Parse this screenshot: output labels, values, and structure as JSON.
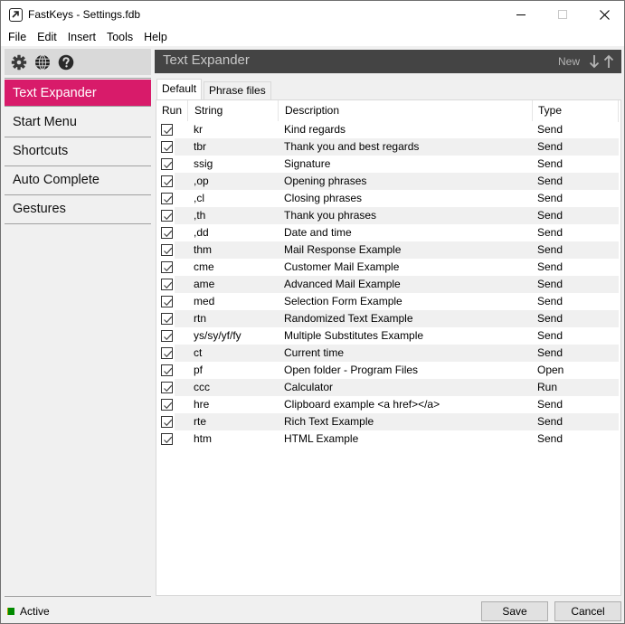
{
  "window": {
    "title": "FastKeys - Settings.fdb",
    "controls": {
      "minimize": "minimize",
      "maximize": "maximize",
      "close": "close"
    }
  },
  "menubar": {
    "items": [
      "File",
      "Edit",
      "Insert",
      "Tools",
      "Help"
    ]
  },
  "sidebar": {
    "toolbar_icons": [
      "gear-icon",
      "globe-icon",
      "help-icon"
    ],
    "items": [
      {
        "label": "Text Expander",
        "active": true
      },
      {
        "label": "Start Menu",
        "active": false
      },
      {
        "label": "Shortcuts",
        "active": false
      },
      {
        "label": "Auto Complete",
        "active": false
      },
      {
        "label": "Gestures",
        "active": false
      }
    ],
    "active_color": "#d81b6a"
  },
  "panel": {
    "title": "Text Expander",
    "new_label": "New",
    "move_down_icon": "arrow-down-icon",
    "move_up_icon": "arrow-up-icon",
    "tabs": [
      {
        "label": "Default",
        "active": true
      },
      {
        "label": "Phrase files",
        "active": false
      }
    ]
  },
  "table": {
    "columns": [
      "Run",
      "String",
      "Description",
      "Type"
    ],
    "rows": [
      {
        "run": true,
        "string": "kr",
        "description": "Kind regards",
        "type": "Send"
      },
      {
        "run": true,
        "string": "tbr",
        "description": "Thank you and best regards",
        "type": "Send"
      },
      {
        "run": true,
        "string": "ssig",
        "description": "Signature",
        "type": "Send"
      },
      {
        "run": true,
        "string": ",op",
        "description": "Opening phrases",
        "type": "Send"
      },
      {
        "run": true,
        "string": ",cl",
        "description": "Closing phrases",
        "type": "Send"
      },
      {
        "run": true,
        "string": ",th",
        "description": "Thank you phrases",
        "type": "Send"
      },
      {
        "run": true,
        "string": ",dd",
        "description": "Date and time",
        "type": "Send"
      },
      {
        "run": true,
        "string": "thm",
        "description": "Mail Response Example",
        "type": "Send"
      },
      {
        "run": true,
        "string": "cme",
        "description": "Customer Mail Example",
        "type": "Send"
      },
      {
        "run": true,
        "string": "ame",
        "description": "Advanced Mail Example",
        "type": "Send"
      },
      {
        "run": true,
        "string": "med",
        "description": "Selection Form Example",
        "type": "Send"
      },
      {
        "run": true,
        "string": "rtn",
        "description": "Randomized Text Example",
        "type": "Send"
      },
      {
        "run": true,
        "string": "ys/sy/yf/fy",
        "description": "Multiple Substitutes Example",
        "type": "Send"
      },
      {
        "run": true,
        "string": "ct",
        "description": "Current time",
        "type": "Send"
      },
      {
        "run": true,
        "string": "pf",
        "description": "Open folder - Program Files",
        "type": "Open"
      },
      {
        "run": true,
        "string": "ccc",
        "description": "Calculator",
        "type": "Run"
      },
      {
        "run": true,
        "string": "hre",
        "description": "Clipboard example <a href></a>",
        "type": "Send"
      },
      {
        "run": true,
        "string": "rte",
        "description": "Rich Text Example",
        "type": "Send"
      },
      {
        "run": true,
        "string": "htm",
        "description": "HTML Example",
        "type": "Send"
      }
    ]
  },
  "status": {
    "label": "Active",
    "color": "#008a00"
  },
  "buttons": {
    "save": "Save",
    "cancel": "Cancel"
  }
}
